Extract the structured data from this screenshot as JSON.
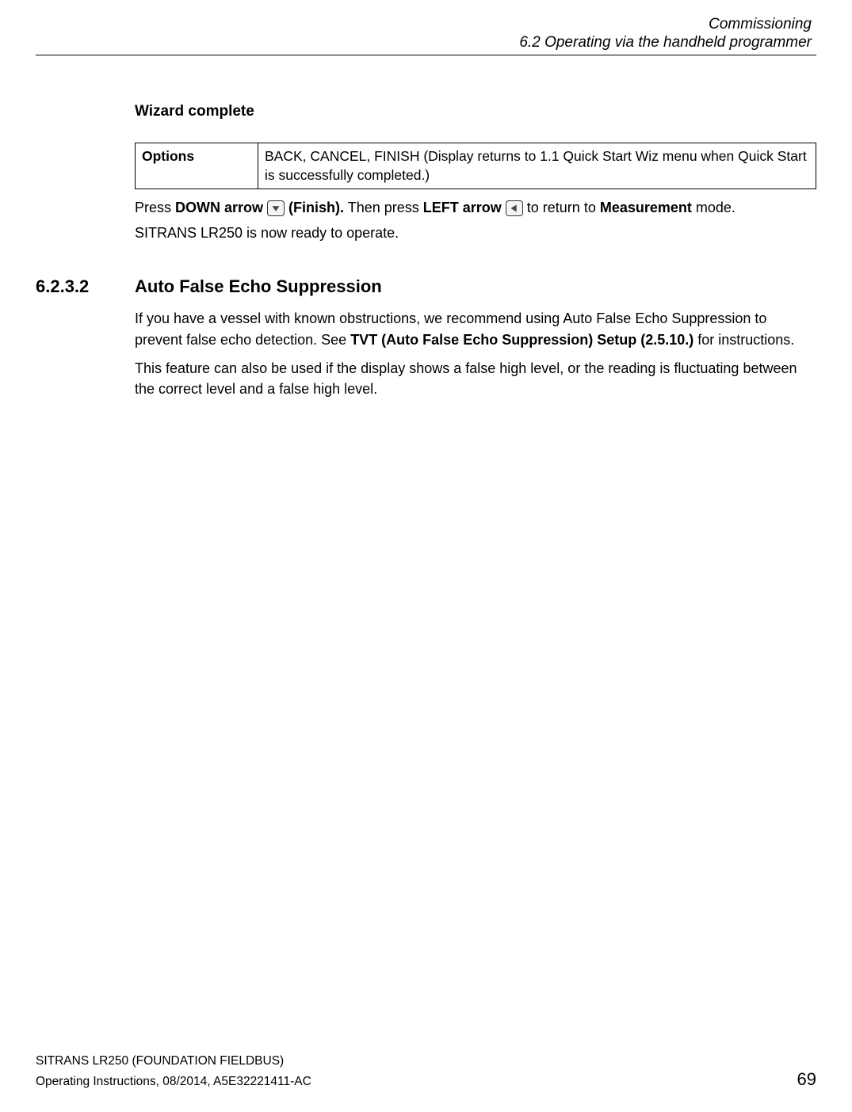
{
  "header": {
    "chapter": "Commissioning",
    "section": "6.2 Operating via the handheld programmer"
  },
  "wizard": {
    "heading": "Wizard complete",
    "table": {
      "label": "Options",
      "value": "BACK, CANCEL, FINISH (Display returns to 1.1 Quick Start Wiz menu when Quick Start is successfully completed.)"
    },
    "instr": {
      "press": "Press ",
      "down_arrow": "DOWN arrow ",
      "finish": " (Finish).",
      "then": " Then press ",
      "left_arrow": "LEFT arrow ",
      "return": " to return to ",
      "measurement": "Measurement",
      "mode": " mode.",
      "ready": "SITRANS LR250 is now ready to operate."
    }
  },
  "section": {
    "num": "6.2.3.2",
    "title": "Auto False Echo Suppression",
    "p1a": "If you have a vessel with known obstructions, we recommend using Auto False Echo Suppression to prevent false echo detection. See ",
    "p1b": "TVT (Auto False Echo Suppression) Setup (2.5.10.)",
    "p1c": " for instructions.",
    "p2": "This feature can also be used if the display shows a false high level, or the reading is fluctuating between the correct level and a false high level."
  },
  "footer": {
    "l1": "SITRANS LR250 (FOUNDATION FIELDBUS)",
    "l2": "Operating Instructions, 08/2014, A5E32221411-AC",
    "page": "69"
  }
}
